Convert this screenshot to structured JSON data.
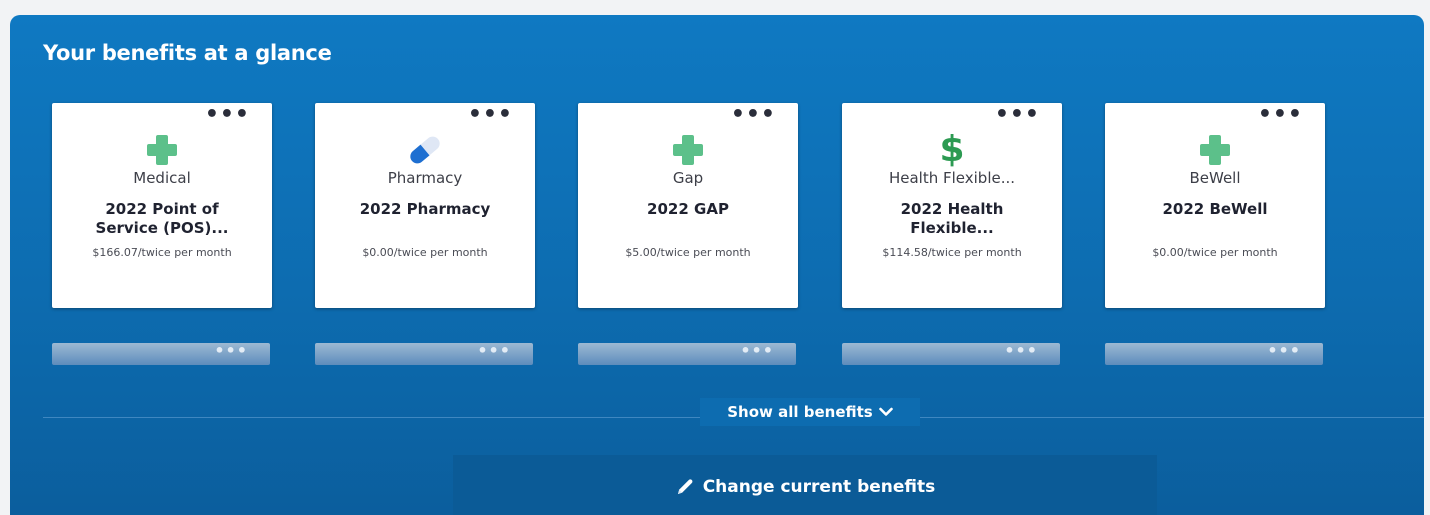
{
  "title": "Your benefits at a glance",
  "more_glyph": "•••",
  "cards": [
    {
      "icon": "plus-cross-icon",
      "category": "Medical",
      "plan_line1": "2022 Point of",
      "plan_line2": "Service (POS)...",
      "cost": "$166.07/twice per month"
    },
    {
      "icon": "pill-capsule-icon",
      "category": "Pharmacy",
      "plan_line1": "2022 Pharmacy",
      "plan_line2": "",
      "cost": "$0.00/twice per month"
    },
    {
      "icon": "plus-cross-icon",
      "category": "Gap",
      "plan_line1": "2022 GAP",
      "plan_line2": "",
      "cost": "$5.00/twice per month"
    },
    {
      "icon": "dollar-sign-icon",
      "dollar_glyph": "$",
      "category": "Health Flexible...",
      "plan_line1": "2022 Health",
      "plan_line2": "Flexible...",
      "cost": "$114.58/twice per month"
    },
    {
      "icon": "plus-cross-icon",
      "category": "BeWell",
      "plan_line1": "2022 BeWell",
      "plan_line2": "",
      "cost": "$0.00/twice per month"
    }
  ],
  "show_all_label": "Show all benefits",
  "change_label": "Change current benefits",
  "colors": {
    "panel": "#0d6cb0",
    "icon_green": "#5cc08a",
    "icon_blue": "#1e6fd1",
    "dollar_green": "#2c9a52"
  }
}
